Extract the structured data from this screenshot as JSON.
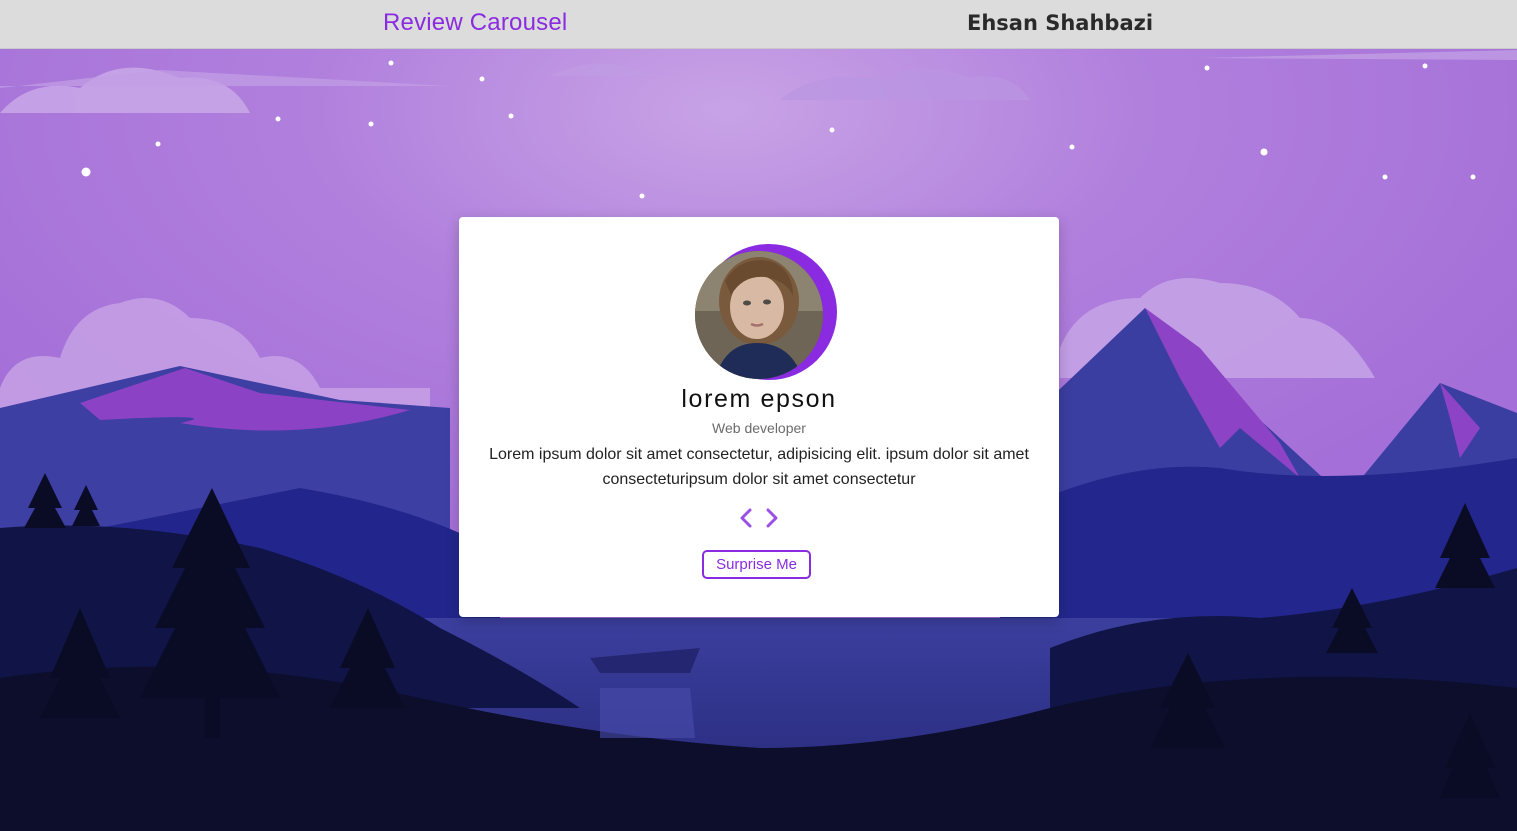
{
  "header": {
    "title": "Review Carousel",
    "author": "Ehsan Shahbazi"
  },
  "review": {
    "name": "lorem epson",
    "job": "Web developer",
    "text": "Lorem ipsum dolor sit amet consectetur, adipisicing elit. ipsum dolor sit amet consecteturipsum dolor sit amet consectetur"
  },
  "controls": {
    "prev_icon": "chevron-left-icon",
    "next_icon": "chevron-right-icon",
    "surprise_label": "Surprise Me"
  },
  "colors": {
    "accent": "#8a2be2",
    "topbar": "#dcdcdc"
  }
}
